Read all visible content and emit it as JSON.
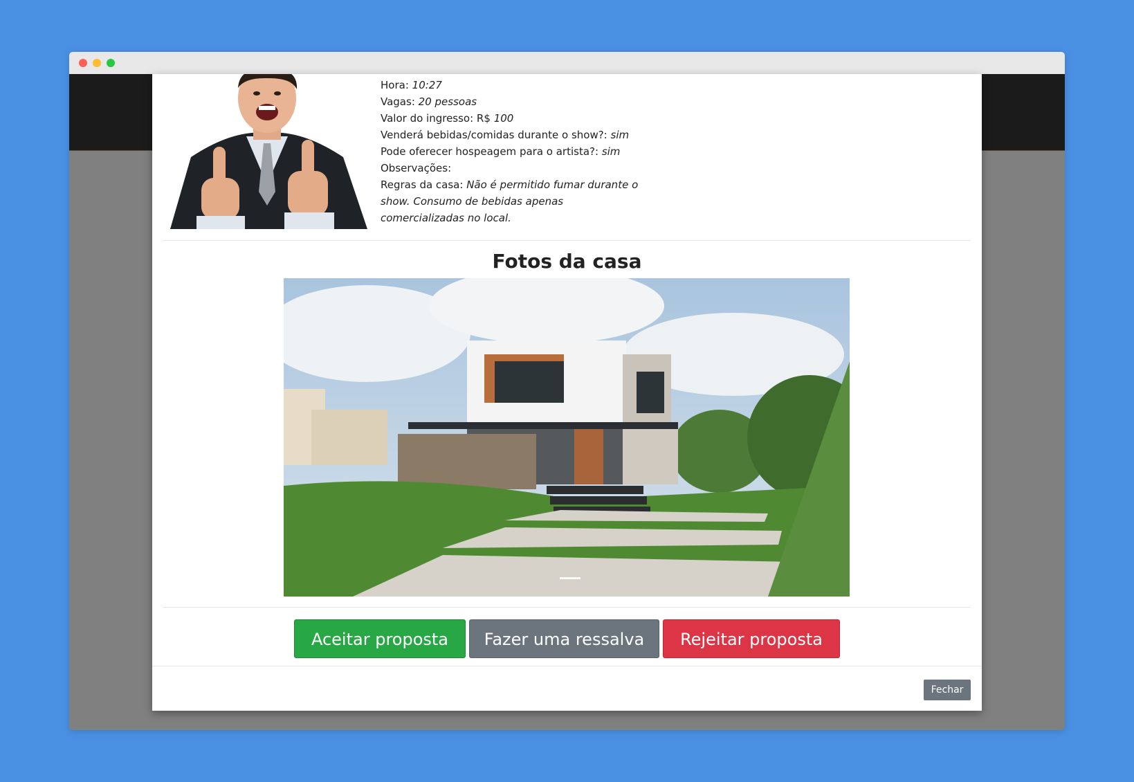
{
  "event_info": {
    "time_label": "Hora:",
    "time_value": "10:27",
    "spots_label": "Vagas:",
    "spots_value": "20 pessoas",
    "ticket_label": "Valor do ingresso: R$",
    "ticket_value": "100",
    "sell_food_label": "Venderá bebidas/comidas durante o show?:",
    "sell_food_value": "sim",
    "lodging_label": "Pode oferecer hospeagem para o artista?:",
    "lodging_value": "sim",
    "notes_label": "Observações:",
    "house_rules_label": "Regras da casa:",
    "house_rules_value": "Não é permitido fumar durante o show. Consumo de bebidas apenas comercializadas no local."
  },
  "photos": {
    "title": "Fotos da casa"
  },
  "actions": {
    "accept_label": "Aceitar proposta",
    "reserve_label": "Fazer uma ressalva",
    "reject_label": "Rejeitar proposta"
  },
  "footer": {
    "close_label": "Fechar"
  },
  "colors": {
    "accept": "#28a745",
    "reserve": "#6c757d",
    "reject": "#dc3545",
    "background": "#4a90e2"
  }
}
